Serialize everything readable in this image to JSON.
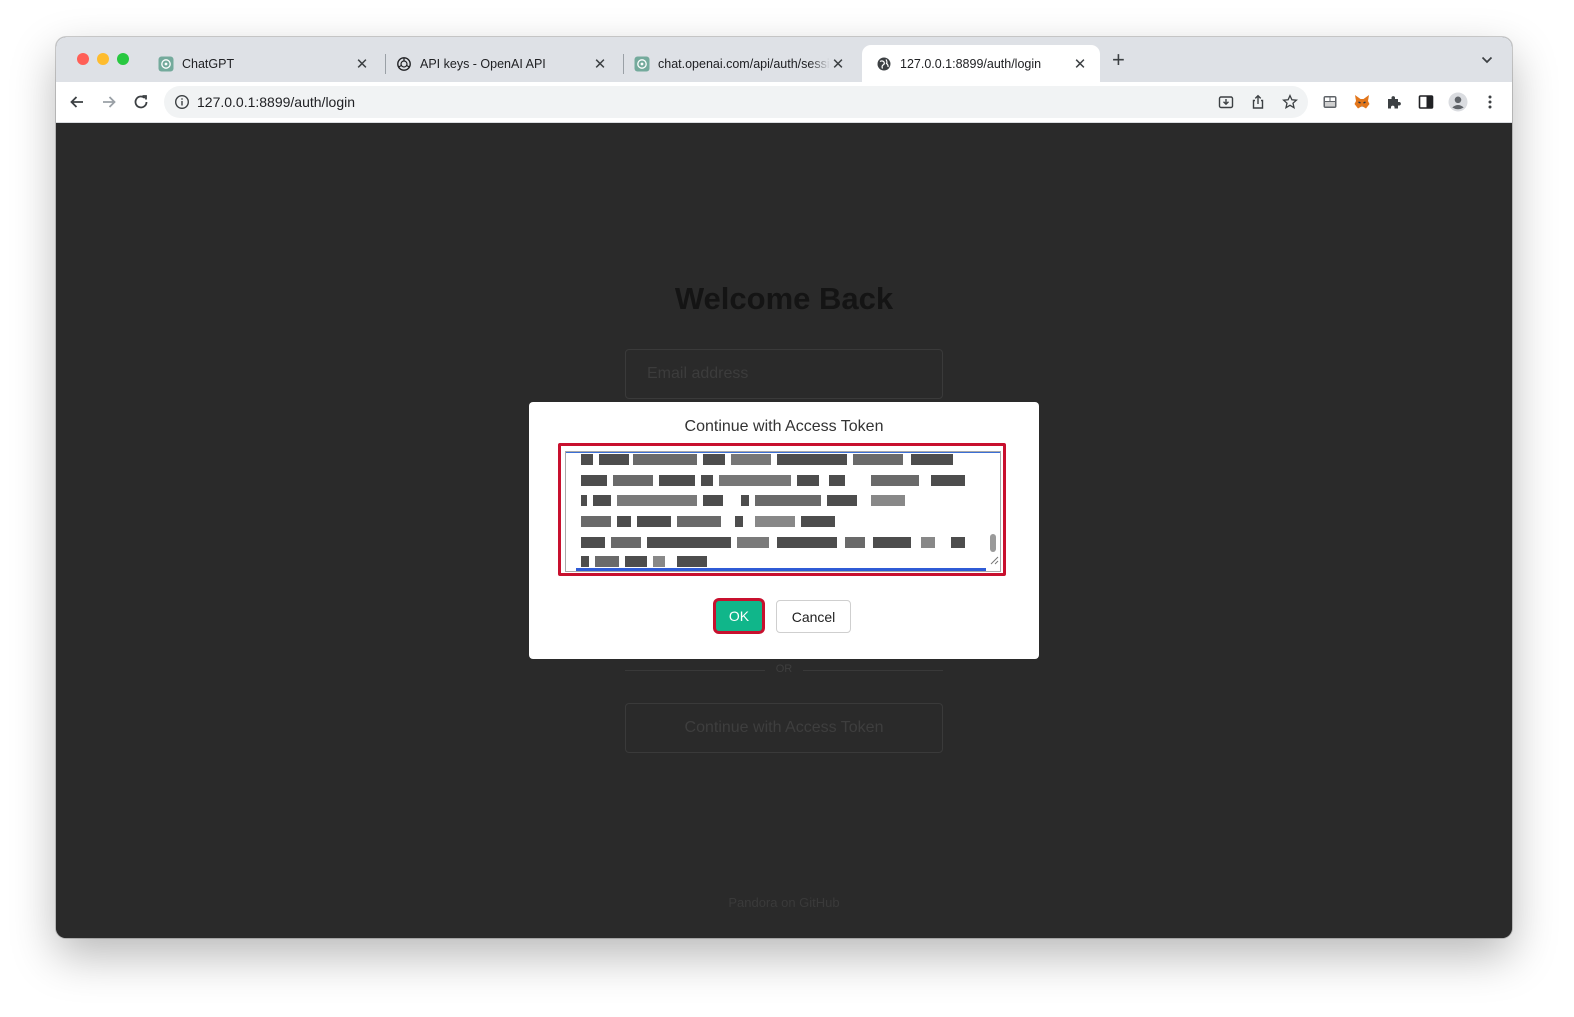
{
  "browser": {
    "tabs": [
      {
        "title": "ChatGPT",
        "icon": "openai-icon",
        "active": false
      },
      {
        "title": "API keys - OpenAI API",
        "icon": "openai-icon",
        "active": false
      },
      {
        "title": "chat.openai.com/api/auth/session",
        "icon": "openai-icon",
        "active": false
      },
      {
        "title": "127.0.0.1:8899/auth/login",
        "icon": "globe-icon",
        "active": true
      }
    ],
    "close_glyph": "✕",
    "new_tab_glyph": "+",
    "address": "127.0.0.1:8899/auth/login"
  },
  "page": {
    "heading": "Welcome Back",
    "email_placeholder": "Email address",
    "or_label": "OR",
    "continue_token_label": "Continue with Access Token",
    "footer": "Pandora on GitHub"
  },
  "dialog": {
    "title": "Continue with Access Token",
    "ok_label": "OK",
    "cancel_label": "Cancel"
  },
  "colors": {
    "ok_button": "#10b68a",
    "highlight": "#c8102e",
    "page_background": "#2a2a2a"
  }
}
